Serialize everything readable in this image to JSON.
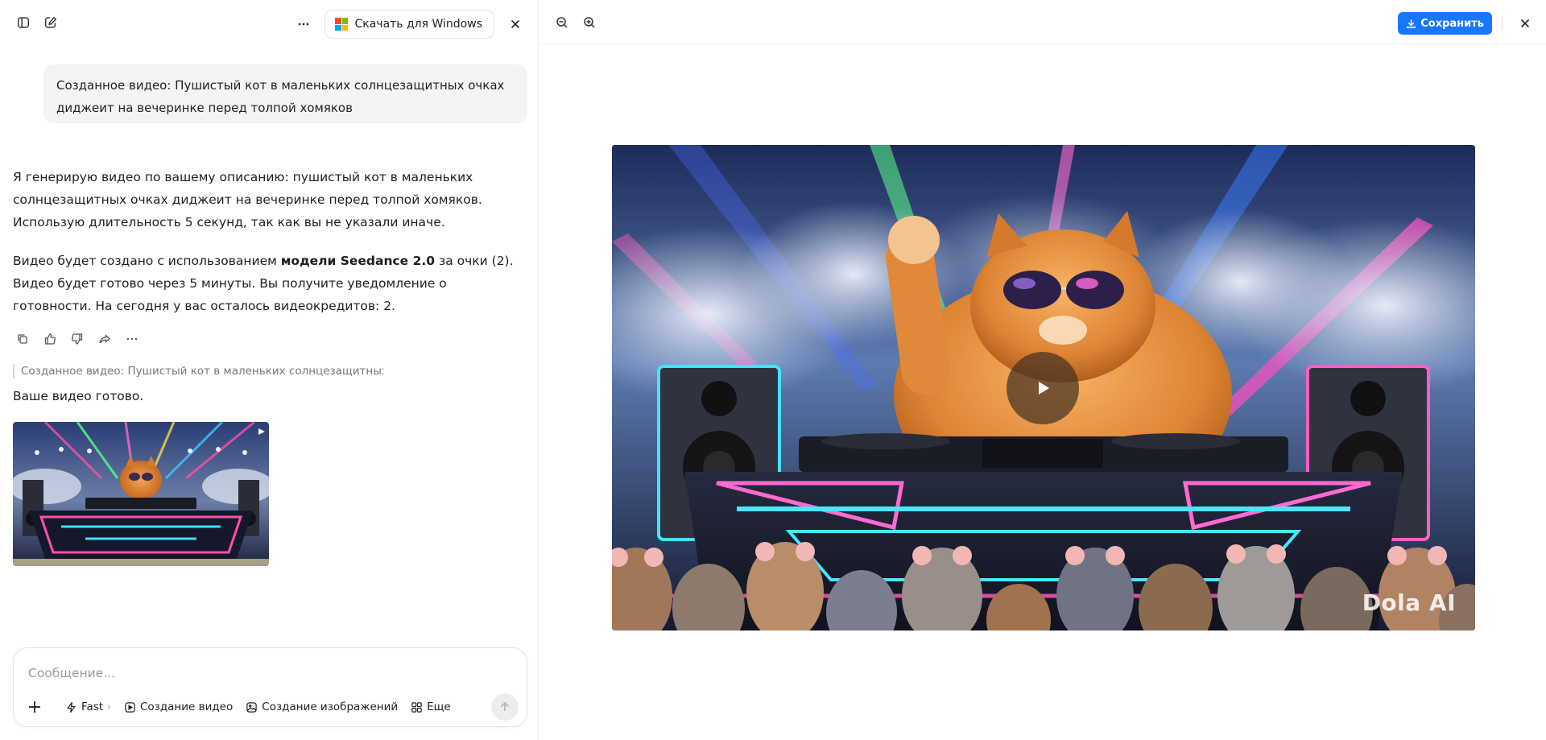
{
  "topbar": {
    "download_label": "Скачать для Windows"
  },
  "chat": {
    "user_message": "Созданное видео: Пушистый кот в маленьких солнцезащитных очках диджеит на вечеринке перед толпой хомяков",
    "bot_p1": "Я генерирую видео по вашему описанию: пушистый кот в маленьких солнцезащитных очках диджеит на вечеринке перед толпой хомяков. Использую длительность 5 секунд, так как вы не указали иначе.",
    "bot_p2_pre": "Видео будет создано с использованием ",
    "bot_p2_bold": "модели Seedance 2.0",
    "bot_p2_post": " за очки (2). Видео будет готово через 5 минуты. Вы получите уведомление о готовности. На сегодня у вас осталось видеокредитов: 2.",
    "reference": "Созданное видео: Пушистый кот в маленьких солнцезащитных о...",
    "ready_text": "Ваше видео готово."
  },
  "composer": {
    "placeholder": "Сообщение...",
    "chips": {
      "fast": "Fast",
      "video": "Создание видео",
      "image": "Создание изображений",
      "more": "Еще"
    }
  },
  "viewer": {
    "save_label": "Сохранить",
    "watermark": "Dola AI"
  },
  "colors": {
    "accent": "#1677ff"
  }
}
